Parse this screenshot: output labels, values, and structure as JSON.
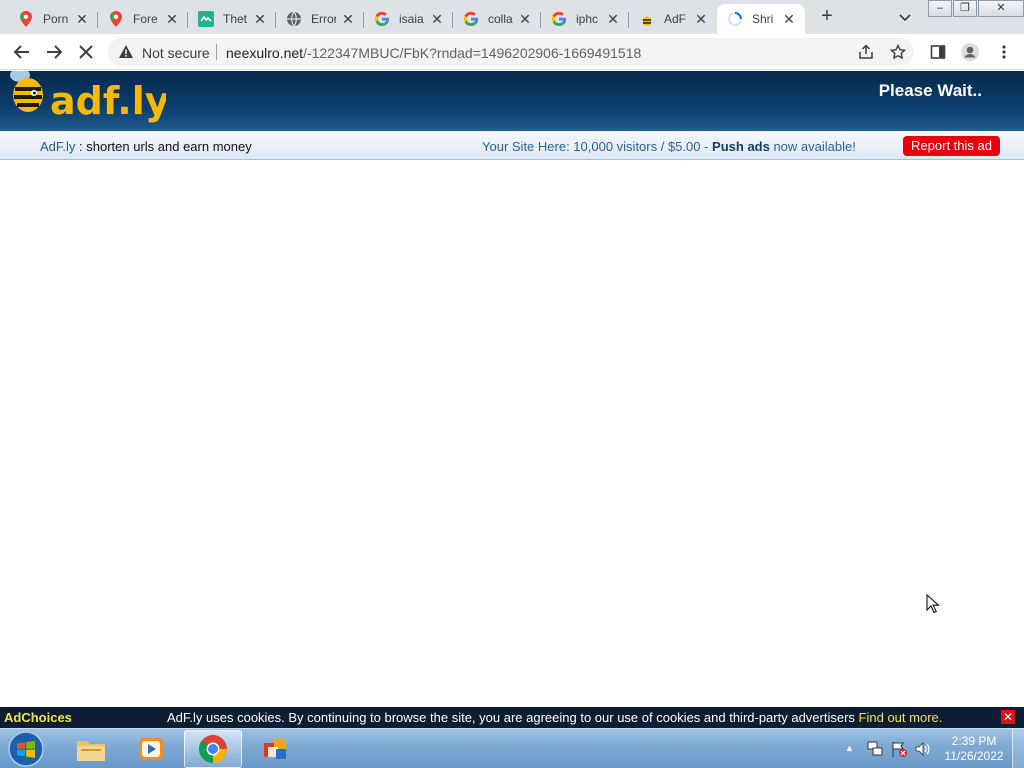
{
  "browser": {
    "tabs": [
      {
        "title": "Porn",
        "icon": "maps-pin-icon"
      },
      {
        "title": "Fore",
        "icon": "maps-pin-icon"
      },
      {
        "title": "Thet",
        "icon": "site-green-icon"
      },
      {
        "title": "Error",
        "icon": "globe-icon"
      },
      {
        "title": "isaia",
        "icon": "google-icon"
      },
      {
        "title": "colla",
        "icon": "google-icon"
      },
      {
        "title": "iphc",
        "icon": "google-icon"
      },
      {
        "title": "AdF",
        "icon": "adfly-bee-icon"
      },
      {
        "title": "Shri",
        "icon": "loading-spinner-icon",
        "active": true
      }
    ],
    "close_glyph": "✕",
    "new_tab_glyph": "+",
    "security_label": "Not secure",
    "url_host": "neexulro.net",
    "url_path": "/-122347MBUC/FbK?rndad=1496202906-1669491518"
  },
  "page": {
    "logo_text": "adf.ly",
    "status": "Please Wait..",
    "info_brand": "AdF.ly",
    "info_tagline": " : shorten urls and earn money",
    "promo_prefix": "Your Site Here: 10,000 visitors / $5.00 - ",
    "promo_bold": "Push ads",
    "promo_suffix": " now available!",
    "report_button": "Report this ad"
  },
  "cookie_bar": {
    "adchoices": "AdChoices",
    "text": "AdF.ly uses cookies. By continuing to browse the site, you are agreeing to our use of cookies and third-party advertisers ",
    "link": "Find out more.",
    "close_glyph": "✕"
  },
  "taskbar": {
    "apps": [
      "file-explorer-icon",
      "media-player-icon",
      "chrome-icon",
      "office-icon"
    ],
    "time": "2:39 PM",
    "date": "11/26/2022"
  },
  "colors": {
    "header_dark": "#062a4c",
    "report_red": "#e8000b",
    "link_yellow": "#f4e04d"
  }
}
